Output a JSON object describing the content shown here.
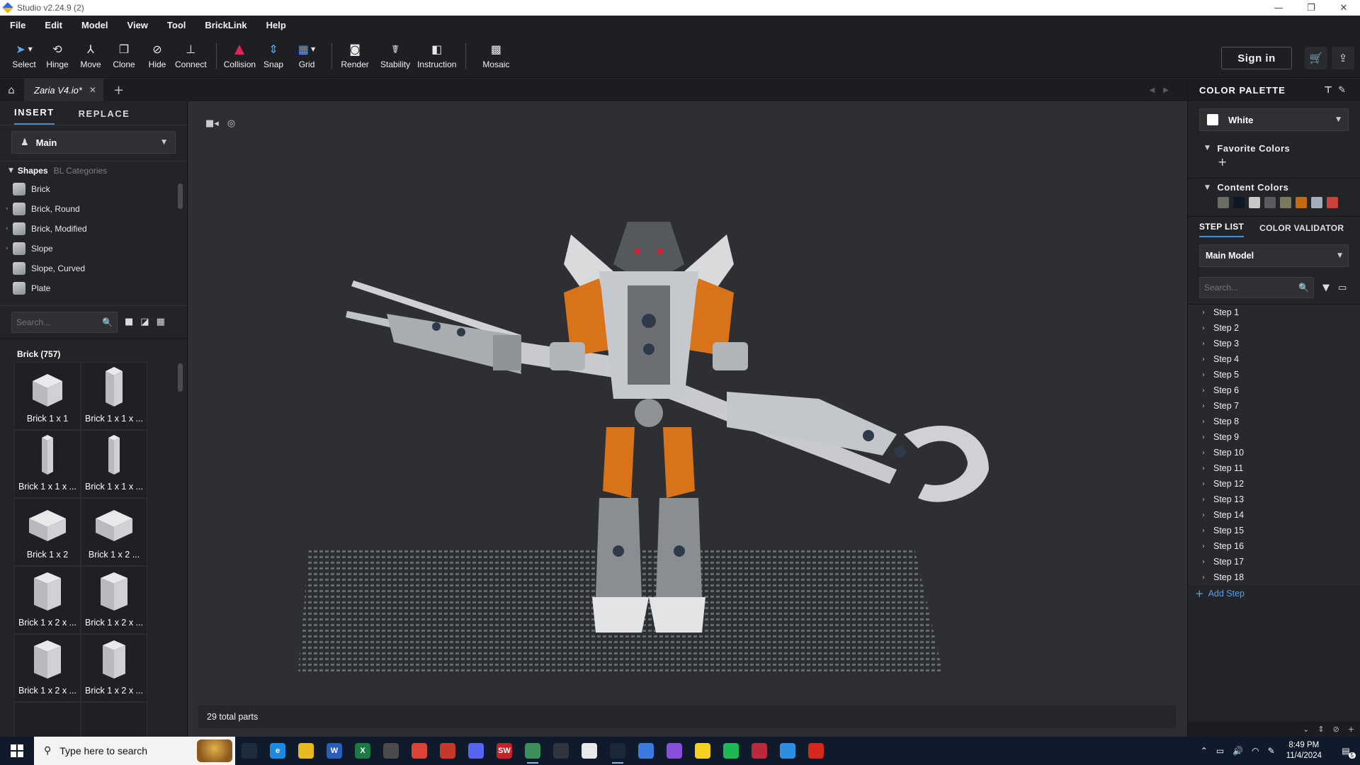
{
  "window": {
    "title": "Studio v2.24.9 (2)",
    "controls": [
      "—",
      "❐",
      "✕"
    ]
  },
  "menu": [
    "File",
    "Edit",
    "Model",
    "View",
    "Tool",
    "BrickLink",
    "Help"
  ],
  "toolbar": {
    "tools": [
      {
        "label": "Select",
        "icon": "cursor-icon"
      },
      {
        "label": "Hinge",
        "icon": "hinge-icon"
      },
      {
        "label": "Move",
        "icon": "move-icon"
      },
      {
        "label": "Clone",
        "icon": "clone-icon"
      },
      {
        "label": "Hide",
        "icon": "hide-icon"
      },
      {
        "label": "Connect",
        "icon": "connect-icon"
      },
      {
        "label": "Collision",
        "icon": "collision-icon"
      },
      {
        "label": "Snap",
        "icon": "snap-icon"
      },
      {
        "label": "Grid",
        "icon": "grid-icon"
      },
      {
        "label": "Render",
        "icon": "render-icon"
      },
      {
        "label": "Stability",
        "icon": "stability-icon"
      },
      {
        "label": "Instruction",
        "icon": "instruction-icon"
      },
      {
        "label": "Mosaic",
        "icon": "mosaic-icon"
      }
    ],
    "sign_in": "Sign in",
    "collision_color": "#e0245e"
  },
  "tabs": {
    "active_file": "Zaria V4.io*"
  },
  "left_panel": {
    "tabs": [
      "INSERT",
      "REPLACE"
    ],
    "set_select": "Main",
    "shapes_header": "Shapes",
    "bl_categories": "BL Categories",
    "shapes": [
      {
        "name": "Brick",
        "expandable": false
      },
      {
        "name": "Brick, Round",
        "expandable": true
      },
      {
        "name": "Brick, Modified",
        "expandable": true
      },
      {
        "name": "Slope",
        "expandable": true
      },
      {
        "name": "Slope, Curved",
        "expandable": false
      },
      {
        "name": "Plate",
        "expandable": false
      }
    ],
    "search_placeholder": "Search...",
    "brick_count": "Brick (757)",
    "bricks": [
      "Brick 1 x 1",
      "Brick 1 x 1 x ...",
      "Brick 1 x 1 x ...",
      "Brick 1 x 1 x ...",
      "Brick 1 x 2",
      "Brick 1 x 2 ...",
      "Brick 1 x 2 x ...",
      "Brick 1 x 2 x ...",
      "Brick 1 x 2 x ...",
      "Brick 1 x 2 x ..."
    ]
  },
  "viewport": {
    "status": "29 total parts"
  },
  "right_panel": {
    "title": "COLOR PALETTE",
    "selected_color": "White",
    "favorite_colors": "Favorite Colors",
    "content_colors_label": "Content Colors",
    "content_colors": [
      "#6b6e63",
      "#0d1a26",
      "#c8c9c7",
      "#5a5b5d",
      "#7a7a5c",
      "#c46a11",
      "#a3aeb8",
      "#c9433a"
    ],
    "step_tabs": [
      "STEP LIST",
      "COLOR VALIDATOR"
    ],
    "model_select": "Main Model",
    "search_placeholder": "Search...",
    "steps": [
      "Step 1",
      "Step 2",
      "Step 3",
      "Step 4",
      "Step 5",
      "Step 6",
      "Step 7",
      "Step 8",
      "Step 9",
      "Step 10",
      "Step 11",
      "Step 12",
      "Step 13",
      "Step 14",
      "Step 15",
      "Step 16",
      "Step 17",
      "Step 18"
    ],
    "add_step": "Add Step"
  },
  "taskbar": {
    "search_placeholder": "Type here to search",
    "time": "8:49 PM",
    "date": "11/4/2024",
    "notifications": "5",
    "apps": [
      {
        "name": "task-view",
        "color": "#1f2c40",
        "text": ""
      },
      {
        "name": "edge",
        "color": "#1b8ae0",
        "text": "e"
      },
      {
        "name": "file-explorer",
        "color": "#e8b91e",
        "text": ""
      },
      {
        "name": "word",
        "color": "#2b5eb8",
        "text": "W"
      },
      {
        "name": "excel",
        "color": "#1e7a45",
        "text": "X"
      },
      {
        "name": "minecraft",
        "color": "#4b4b4b",
        "text": ""
      },
      {
        "name": "chrome",
        "color": "#db4437",
        "text": ""
      },
      {
        "name": "chrome-2",
        "color": "#c6382c",
        "text": ""
      },
      {
        "name": "discord",
        "color": "#5865f2",
        "text": ""
      },
      {
        "name": "solidworks",
        "color": "#c5212b",
        "text": "SW"
      },
      {
        "name": "bricklink-studio",
        "color": "#3e8e5a",
        "text": ""
      },
      {
        "name": "palette-app",
        "color": "#2f3440",
        "text": ""
      },
      {
        "name": "penguin-app",
        "color": "#e9e9e9",
        "text": ""
      },
      {
        "name": "steam",
        "color": "#1b2838",
        "text": ""
      },
      {
        "name": "arc-app",
        "color": "#3b7be0",
        "text": ""
      },
      {
        "name": "purple-app",
        "color": "#8a4fd8",
        "text": ""
      },
      {
        "name": "sticky-notes",
        "color": "#f6d11c",
        "text": ""
      },
      {
        "name": "spotify",
        "color": "#1db954",
        "text": ""
      },
      {
        "name": "red-tool",
        "color": "#b92b3c",
        "text": ""
      },
      {
        "name": "photos",
        "color": "#2e8fe0",
        "text": ""
      },
      {
        "name": "acrobat",
        "color": "#d6271d",
        "text": ""
      }
    ]
  }
}
